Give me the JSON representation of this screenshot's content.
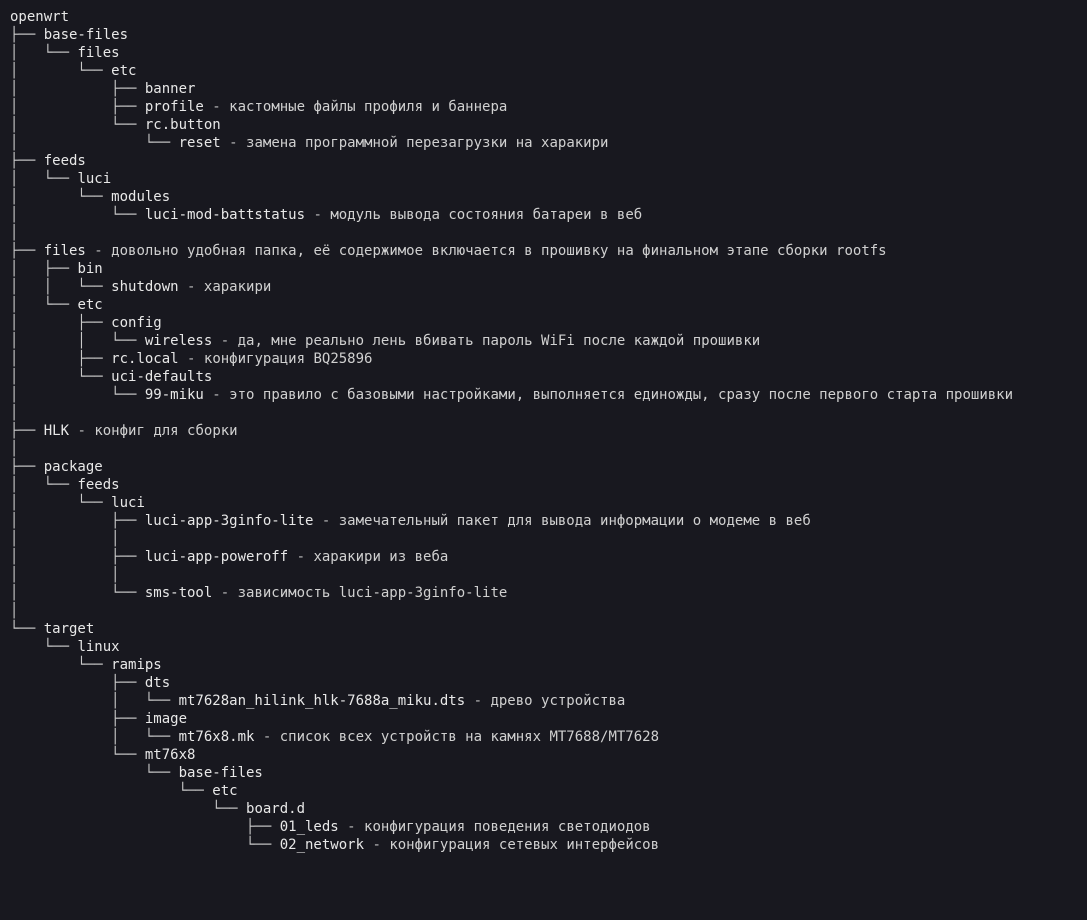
{
  "lines": [
    {
      "prefix": "",
      "name": "openwrt",
      "desc": ""
    },
    {
      "prefix": "├── ",
      "name": "base-files",
      "desc": ""
    },
    {
      "prefix": "│   └── ",
      "name": "files",
      "desc": ""
    },
    {
      "prefix": "│       └── ",
      "name": "etc",
      "desc": ""
    },
    {
      "prefix": "│           ├── ",
      "name": "banner",
      "desc": ""
    },
    {
      "prefix": "│           ├── ",
      "name": "profile",
      "desc": "кастомные файлы профиля и баннера"
    },
    {
      "prefix": "│           └── ",
      "name": "rc.button",
      "desc": ""
    },
    {
      "prefix": "│               └── ",
      "name": "reset",
      "desc": "замена программной перезагрузки на харакири"
    },
    {
      "prefix": "├── ",
      "name": "feeds",
      "desc": ""
    },
    {
      "prefix": "│   └── ",
      "name": "luci",
      "desc": ""
    },
    {
      "prefix": "│       └── ",
      "name": "modules",
      "desc": ""
    },
    {
      "prefix": "│           └── ",
      "name": "luci-mod-battstatus",
      "desc": "модуль вывода состояния батареи в веб"
    },
    {
      "prefix": "│",
      "name": "",
      "desc": ""
    },
    {
      "prefix": "├── ",
      "name": "files",
      "desc": "довольно удобная папка, её содержимое включается в прошивку на финальном этапе сборки rootfs"
    },
    {
      "prefix": "│   ├── ",
      "name": "bin",
      "desc": ""
    },
    {
      "prefix": "│   │   └── ",
      "name": "shutdown",
      "desc": "харакири"
    },
    {
      "prefix": "│   └── ",
      "name": "etc",
      "desc": ""
    },
    {
      "prefix": "│       ├── ",
      "name": "config",
      "desc": ""
    },
    {
      "prefix": "│       │   └── ",
      "name": "wireless",
      "desc": "да, мне реально лень вбивать пароль WiFi после каждой прошивки"
    },
    {
      "prefix": "│       ├── ",
      "name": "rc.local",
      "desc": "конфигурация BQ25896"
    },
    {
      "prefix": "│       └── ",
      "name": "uci-defaults",
      "desc": ""
    },
    {
      "prefix": "│           └── ",
      "name": "99-miku",
      "desc": "это правило с базовыми настройками, выполняется единожды, сразу после первого старта прошивки"
    },
    {
      "prefix": "│",
      "name": "",
      "desc": ""
    },
    {
      "prefix": "├── ",
      "name": "HLK",
      "desc": "конфиг для сборки"
    },
    {
      "prefix": "│",
      "name": "",
      "desc": ""
    },
    {
      "prefix": "├── ",
      "name": "package",
      "desc": ""
    },
    {
      "prefix": "│   └── ",
      "name": "feeds",
      "desc": ""
    },
    {
      "prefix": "│       └── ",
      "name": "luci",
      "desc": ""
    },
    {
      "prefix": "│           ├── ",
      "name": "luci-app-3ginfo-lite",
      "desc": "замечательный пакет для вывода информации о модеме в веб"
    },
    {
      "prefix": "│           │",
      "name": "",
      "desc": ""
    },
    {
      "prefix": "│           ├── ",
      "name": "luci-app-poweroff",
      "desc": "харакири из веба"
    },
    {
      "prefix": "│           │",
      "name": "",
      "desc": ""
    },
    {
      "prefix": "│           └── ",
      "name": "sms-tool",
      "desc": "зависимость luci-app-3ginfo-lite"
    },
    {
      "prefix": "│",
      "name": "",
      "desc": ""
    },
    {
      "prefix": "└── ",
      "name": "target",
      "desc": ""
    },
    {
      "prefix": "    └── ",
      "name": "linux",
      "desc": ""
    },
    {
      "prefix": "        └── ",
      "name": "ramips",
      "desc": ""
    },
    {
      "prefix": "            ├── ",
      "name": "dts",
      "desc": ""
    },
    {
      "prefix": "            │   └── ",
      "name": "mt7628an_hilink_hlk-7688a_miku.dts",
      "desc": "древо устройства"
    },
    {
      "prefix": "            ├── ",
      "name": "image",
      "desc": ""
    },
    {
      "prefix": "            │   └── ",
      "name": "mt76x8.mk",
      "desc": "список всех устройств на камнях MT7688/MT7628"
    },
    {
      "prefix": "            └── ",
      "name": "mt76x8",
      "desc": ""
    },
    {
      "prefix": "                └── ",
      "name": "base-files",
      "desc": ""
    },
    {
      "prefix": "                    └── ",
      "name": "etc",
      "desc": ""
    },
    {
      "prefix": "                        └── ",
      "name": "board.d",
      "desc": ""
    },
    {
      "prefix": "                            ├── ",
      "name": "01_leds",
      "desc": "конфигурация поведения светодиодов"
    },
    {
      "prefix": "                            └── ",
      "name": "02_network",
      "desc": "конфигурация сетевых интерфейсов"
    }
  ],
  "separator": " - "
}
